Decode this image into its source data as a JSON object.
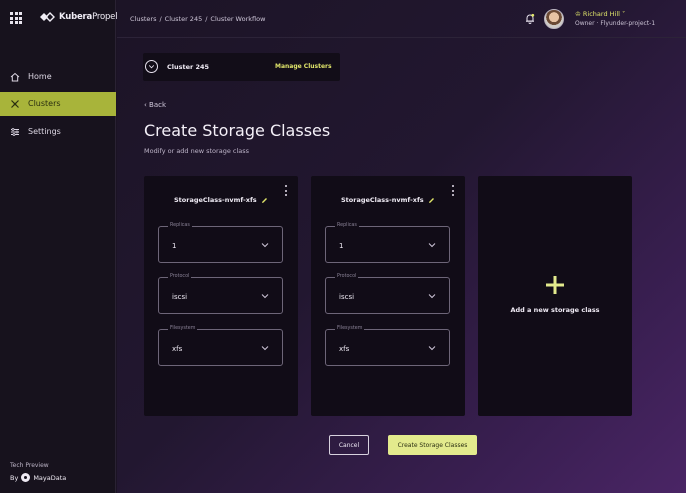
{
  "sidebar": {
    "brand": {
      "bold": "Kubera",
      "light": "Propel"
    },
    "items": [
      {
        "label": "Home",
        "icon": "home-icon"
      },
      {
        "label": "Clusters",
        "icon": "clusters-icon",
        "active": true
      },
      {
        "label": "Settings",
        "icon": "settings-icon"
      }
    ],
    "tech_preview": "Tech Preview",
    "by": "By",
    "maker": "MayaData"
  },
  "header": {
    "breadcrumb": [
      "Clusters",
      "Cluster 245",
      "Cluster Workflow"
    ],
    "user_name": "Richard Hill",
    "user_role": "Owner · Flyunder-project-1"
  },
  "cluster_bar": {
    "name": "Cluster 245",
    "manage_label": "Manage Clusters"
  },
  "page": {
    "back_label": "Back",
    "title": "Create Storage Classes",
    "subtitle": "Modify or add new storage class"
  },
  "cards": [
    {
      "title": "StorageClass-nvmf-xfs",
      "fields": [
        {
          "label": "Replicas",
          "value": "1"
        },
        {
          "label": "Protocol",
          "value": "iscsi"
        },
        {
          "label": "Filesystem",
          "value": "xfs"
        }
      ]
    },
    {
      "title": "StorageClass-nvmf-xfs",
      "fields": [
        {
          "label": "Replicas",
          "value": "1"
        },
        {
          "label": "Protocol",
          "value": "iscsi"
        },
        {
          "label": "Filesystem",
          "value": "xfs"
        }
      ]
    }
  ],
  "add_card": {
    "label": "Add a new storage class",
    "icon": "plus-icon"
  },
  "actions": {
    "cancel": "Cancel",
    "create": "Create Storage Classes"
  },
  "colors": {
    "accent": "#dfe46a",
    "active_nav": "#a8b43a",
    "button_primary": "#e3ea8d"
  }
}
